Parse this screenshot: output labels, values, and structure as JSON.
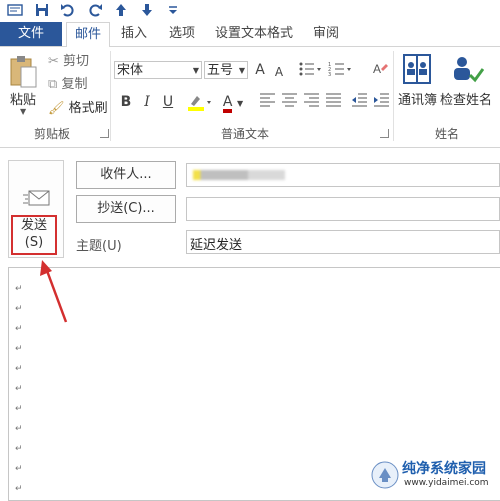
{
  "quick_access": {
    "icons": [
      "outlook-icon",
      "save-icon",
      "undo-icon",
      "redo-icon",
      "up-icon",
      "down-icon",
      "customize-icon"
    ]
  },
  "tabs": [
    {
      "label": "文件"
    },
    {
      "label": "邮件"
    },
    {
      "label": "插入"
    },
    {
      "label": "选项"
    },
    {
      "label": "设置文本格式"
    },
    {
      "label": "审阅"
    }
  ],
  "clipboard": {
    "paste_label": "粘贴",
    "cut_label": "剪切",
    "copy_label": "复制",
    "format_painter_label": "格式刷",
    "group_label": "剪贴板"
  },
  "basic_text": {
    "font_name": "宋体",
    "font_size": "五号",
    "grow_font": "A",
    "shrink_font": "A",
    "bold": "B",
    "italic": "I",
    "underline": "U",
    "font_color": "A",
    "group_label": "普通文本",
    "highlight_color": "#ffff00",
    "font_color_hex": "#c00000"
  },
  "names": {
    "address_book_label": "通讯簿",
    "check_names_label": "检查姓名",
    "group_label": "姓名"
  },
  "compose": {
    "send_label": "发送",
    "send_shortcut": "(S)",
    "to_button": "收件人...",
    "cc_button": "抄送(C)...",
    "subject_label": "主题(U)",
    "subject_value": "延迟发送",
    "accent": "#2b579a"
  },
  "watermark": {
    "text": "纯净系统家园",
    "url": "www.yidaimei.com"
  }
}
